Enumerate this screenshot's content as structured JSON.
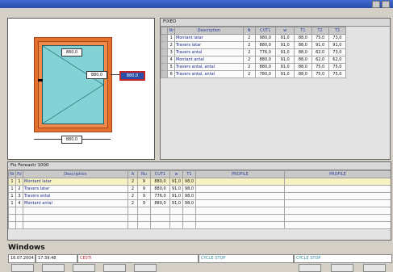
{
  "window": {
    "title": ""
  },
  "drawing": {
    "dims": {
      "top": "880,0",
      "right": "880,0",
      "bottom": "880,0",
      "selected": "880,0"
    }
  },
  "top_grid": {
    "title": "FIXED",
    "columns": [
      "Nr",
      "Description",
      "N",
      "CUT1",
      "w",
      "T1",
      "T2",
      "T3"
    ],
    "rows": [
      [
        "1",
        "Montant latar",
        "2",
        "980,0",
        "91,0",
        "88,0",
        "75,0",
        "73,0"
      ],
      [
        "2",
        "Travers latar",
        "2",
        "880,0",
        "91,0",
        "88,0",
        "91,0",
        "91,0"
      ],
      [
        "3",
        "Travers antal",
        "2",
        "776,0",
        "91,0",
        "88,0",
        "62,0",
        "73,0"
      ],
      [
        "4",
        "Montant antal",
        "2",
        "880,0",
        "91,0",
        "88,0",
        "62,0",
        "62,0"
      ],
      [
        "5",
        "Travers antal, antal",
        "2",
        "880,0",
        "91,0",
        "88,0",
        "75,0",
        "75,0"
      ],
      [
        "6",
        "Travers antal, antal",
        "2",
        "780,0",
        "91,0",
        "88,0",
        "75,0",
        "75,0"
      ]
    ]
  },
  "bottom_grid": {
    "title": "Fix Fereastr 1000",
    "columns": [
      "Nr",
      "Pz",
      "Description",
      "A",
      "Nu",
      "CUT1",
      "w",
      "T1",
      "PROFILE",
      "PROFILE"
    ],
    "rows": [
      [
        "1",
        "1",
        "Montant latar",
        "2",
        "9",
        "880,0",
        "91,0",
        "98,0",
        "",
        ""
      ],
      [
        "1",
        "2",
        "Travers latar",
        "2",
        "9",
        "880,0",
        "91,0",
        "98,0",
        "",
        ""
      ],
      [
        "1",
        "3",
        "Travers antal",
        "2",
        "9",
        "776,0",
        "91,0",
        "98,0",
        "",
        ""
      ],
      [
        "1",
        "4",
        "Montant antal",
        "2",
        "9",
        "880,0",
        "91,0",
        "98,0",
        "",
        ""
      ]
    ]
  },
  "status": {
    "label": "Windows",
    "date": "16.07.2004",
    "time": "17:39:48",
    "msg": "CESTI",
    "cycle1": "CYCLE STOP",
    "cycle2": "CYCLE STOP"
  },
  "colors": {
    "glass": "#83d2d6",
    "frame": "#e56f2c",
    "titlebar": "#2a4fa8"
  }
}
